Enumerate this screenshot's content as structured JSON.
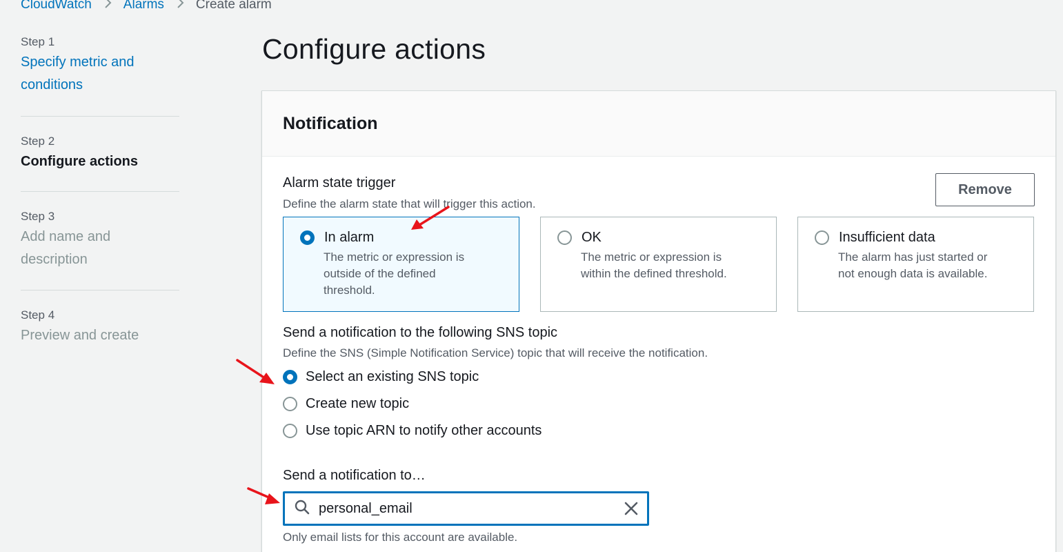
{
  "breadcrumb": {
    "items": [
      "CloudWatch",
      "Alarms"
    ],
    "current": "Create alarm",
    "separator": ">"
  },
  "steps": [
    {
      "num": "Step 1",
      "title_line1": "Specify metric and",
      "title_line2": "conditions",
      "state": "link"
    },
    {
      "num": "Step 2",
      "title_line1": "Configure actions",
      "state": "active"
    },
    {
      "num": "Step 3",
      "title_line1": "Add name and",
      "title_line2": "description",
      "state": "disabled"
    },
    {
      "num": "Step 4",
      "title_line1": "Preview and create",
      "state": "disabled"
    }
  ],
  "page_title": "Configure actions",
  "notification": {
    "header": "Notification",
    "remove_label": "Remove",
    "trigger": {
      "label": "Alarm state trigger",
      "description": "Define the alarm state that will trigger this action.",
      "options": [
        {
          "label": "In alarm",
          "desc_line1": "The metric or expression is",
          "desc_line2": "outside of the defined",
          "desc_line3": "threshold.",
          "selected": true
        },
        {
          "label": "OK",
          "desc_line1": "The metric or expression is",
          "desc_line2": "within the defined threshold.",
          "selected": false
        },
        {
          "label": "Insufficient data",
          "desc_line1": "The alarm has just started or",
          "desc_line2": "not enough data is available.",
          "selected": false
        }
      ]
    },
    "sns": {
      "label": "Send a notification to the following SNS topic",
      "description": "Define the SNS (Simple Notification Service) topic that will receive the notification.",
      "options": [
        {
          "label": "Select an existing SNS topic",
          "selected": true
        },
        {
          "label": "Create new topic",
          "selected": false
        },
        {
          "label": "Use topic ARN to notify other accounts",
          "selected": false
        }
      ]
    },
    "send_to": {
      "label": "Send a notification to…",
      "value": "personal_email",
      "hint": "Only email lists for this account are available."
    }
  },
  "colors": {
    "accent": "#0073bb",
    "annotation_arrow": "#e8141b",
    "background": "#f2f3f3"
  }
}
